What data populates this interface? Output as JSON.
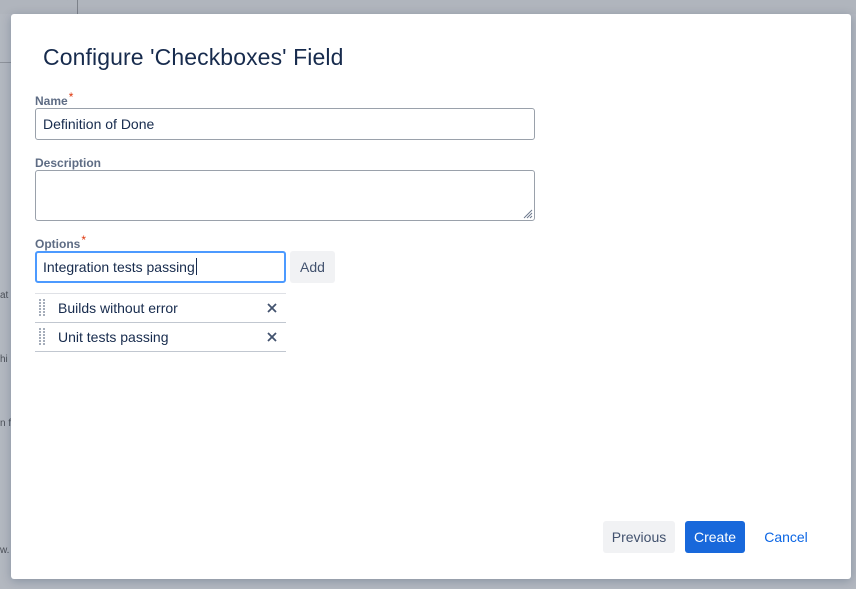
{
  "background": {
    "fragments": [
      "at",
      "hi",
      "n fi",
      "w."
    ]
  },
  "dialog": {
    "title": "Configure 'Checkboxes' Field",
    "name_field": {
      "label": "Name",
      "required_marker": "*",
      "value": "Definition of Done"
    },
    "description_field": {
      "label": "Description",
      "value": ""
    },
    "options_field": {
      "label": "Options",
      "required_marker": "*",
      "input_value": "Integration tests passing",
      "add_label": "Add",
      "items": [
        {
          "label": "Builds without error"
        },
        {
          "label": "Unit tests passing"
        }
      ]
    },
    "footer": {
      "previous_label": "Previous",
      "create_label": "Create",
      "cancel_label": "Cancel"
    }
  },
  "colors": {
    "primary": "#1868db",
    "focus_border": "#4c9aff",
    "required": "#de350b",
    "link": "#0c66e4"
  },
  "icons": {
    "search": "search-icon",
    "remove": "close-icon",
    "drag": "drag-handle-icon",
    "resize": "resize-grip-icon"
  }
}
